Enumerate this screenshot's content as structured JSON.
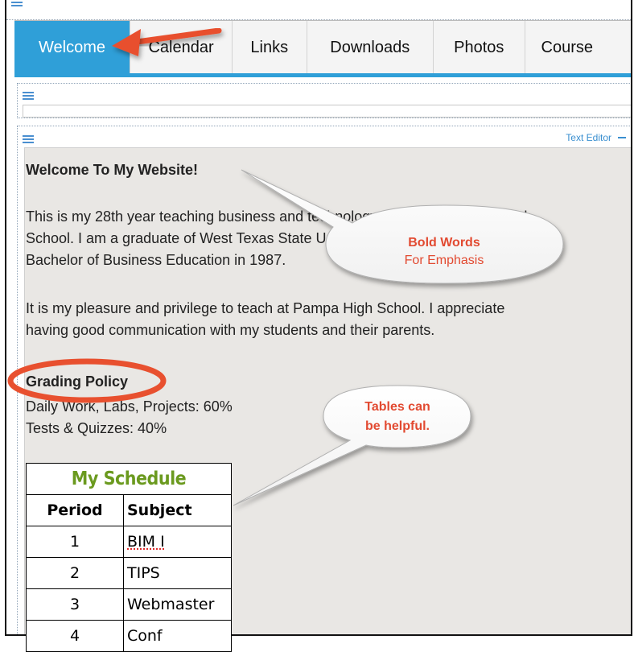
{
  "tabs": [
    {
      "label": "Welcome",
      "active": true
    },
    {
      "label": "Calendar"
    },
    {
      "label": "Links"
    },
    {
      "label": "Downloads"
    },
    {
      "label": "Photos"
    },
    {
      "label": "Course"
    }
  ],
  "editor": {
    "label": "Text Editor",
    "toggle": "−"
  },
  "content": {
    "heading": "Welcome To My Website!",
    "para1_line1": "This is my 28th year teaching business and technology courses at Pampa High",
    "para1_line2": "School. I am a graduate of West Texas State University where I earned a",
    "para1_line3": "Bachelor of Business Education in 1987.",
    "para2_line1": "It is my pleasure and privilege to teach at Pampa High School. I appreciate",
    "para2_line2": "having good communication with my students and their parents.",
    "policy_heading": "Grading Policy",
    "policy_line1": "Daily Work, Labs, Projects: 60%",
    "policy_line2": "Tests & Quizzes: 40%"
  },
  "schedule": {
    "title": "My Schedule",
    "headers": [
      "Period",
      "Subject"
    ],
    "rows": [
      {
        "period": "1",
        "subject": "BIM I"
      },
      {
        "period": "2",
        "subject": "TIPS"
      },
      {
        "period": "3",
        "subject": "Webmaster"
      },
      {
        "period": "4",
        "subject": "Conf"
      }
    ]
  },
  "callouts": {
    "bold_line1": "Bold Words",
    "bold_line2": "For Emphasis",
    "tables_line1": "Tables can",
    "tables_line2": "be helpful."
  },
  "colors": {
    "accent": "#2f9fd8",
    "callout_text": "#e24a31",
    "annotation": "#e8502f",
    "schedule_title": "#6b9a1f"
  }
}
